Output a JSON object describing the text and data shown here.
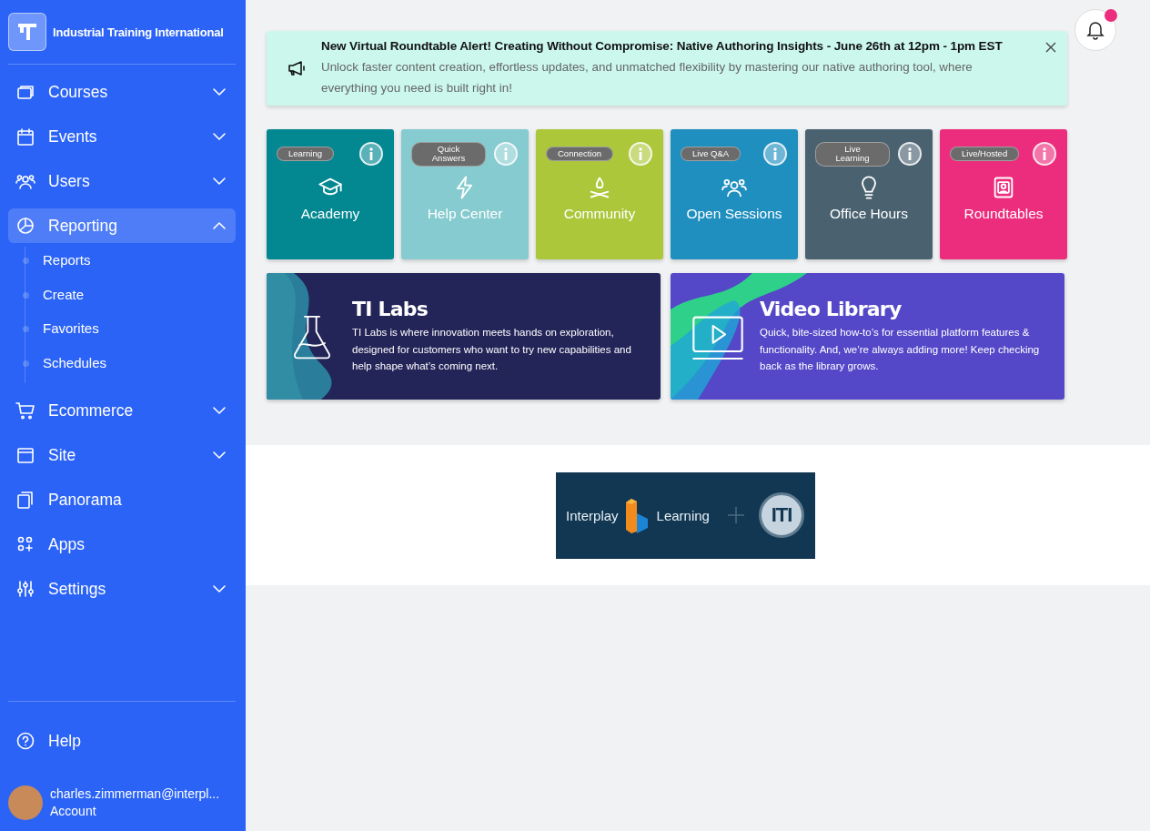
{
  "brand": {
    "name": "Industrial Training International"
  },
  "nav": [
    {
      "label": "Courses",
      "kind": "group",
      "expanded": false,
      "selected": false
    },
    {
      "label": "Events",
      "kind": "group",
      "expanded": false,
      "selected": false
    },
    {
      "label": "Users",
      "kind": "group",
      "expanded": false,
      "selected": false
    },
    {
      "label": "Reporting",
      "kind": "group",
      "expanded": true,
      "selected": true,
      "children": [
        {
          "label": "Reports"
        },
        {
          "label": "Create"
        },
        {
          "label": "Favorites"
        },
        {
          "label": "Schedules"
        }
      ]
    },
    {
      "label": "Ecommerce",
      "kind": "group",
      "expanded": false,
      "selected": false
    },
    {
      "label": "Site",
      "kind": "group",
      "expanded": false,
      "selected": false
    },
    {
      "label": "Panorama",
      "kind": "link",
      "selected": false
    },
    {
      "label": "Apps",
      "kind": "link",
      "selected": false
    },
    {
      "label": "Settings",
      "kind": "group",
      "expanded": false,
      "selected": false
    }
  ],
  "help": {
    "label": "Help"
  },
  "account": {
    "email": "charles.zimmerman@interpl...",
    "label": "Account"
  },
  "notifications": {
    "unread": true
  },
  "alert": {
    "title": "New Virtual Roundtable Alert! Creating Without Compromise: Native Authoring Insights - June 26th at 12pm - 1pm EST",
    "message": "Unlock faster content creation, effortless updates, and unmatched flexibility by mastering our native authoring tool, where everything you need is built right in!"
  },
  "tiles": [
    {
      "tag": "Learning",
      "title": "Academy",
      "color": "#038891"
    },
    {
      "tag": "Quick Answers",
      "title": "Help Center",
      "color": "#86cbcf"
    },
    {
      "tag": "Connection",
      "title": "Community",
      "color": "#adc73b"
    },
    {
      "tag": "Live Q&A",
      "title": "Open Sessions",
      "color": "#1f8fbf"
    },
    {
      "tag": "Live Learning",
      "title": "Office Hours",
      "color": "#4a6170"
    },
    {
      "tag": "Live/Hosted",
      "title": "Roundtables",
      "color": "#ec2d7d"
    }
  ],
  "promos": [
    {
      "title": "TI Labs",
      "text": "TI Labs is where innovation meets hands on exploration, designed for customers who want to try new capabilities and help shape what’s coming next."
    },
    {
      "title": "Video Library",
      "text": "Quick, bite-sized how-to’s for essential platform features & functionality. And, we’re always adding more! Keep checking back as the library grows."
    }
  ],
  "partner": {
    "left": "Interplay",
    "right": "Learning",
    "mark": "ITI"
  }
}
